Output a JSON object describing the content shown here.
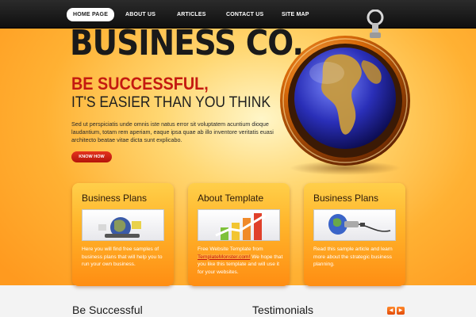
{
  "nav": {
    "items": [
      {
        "label": "HOME PAGE",
        "active": true
      },
      {
        "label": "ABOUT US",
        "active": false
      },
      {
        "label": "ARTICLES",
        "active": false
      },
      {
        "label": "CONTACT US",
        "active": false
      },
      {
        "label": "SITE MAP",
        "active": false
      }
    ]
  },
  "brand": {
    "name": "BUSINESS CO."
  },
  "hero": {
    "headline_line1": "BE SUCCESSFUL,",
    "headline_line2": "IT'S EASIER THAN YOU THINK",
    "intro": "Sed ut perspiciatis unde omnis iste natus error sit voluptatem acuntium dioque laudantium, totam rem aperiam, eaque ipsa quae ab illo inventore veritatis euasi architecto beatae vitae dicta sunt explicabo.",
    "button_label": "KNOW HOW"
  },
  "cards": [
    {
      "title": "Business Plans",
      "text_before": "Here you will find free samples of business plans that will help you to run your own business.",
      "link": "",
      "text_after": ""
    },
    {
      "title": "About Template",
      "text_before": "Free Website Template from ",
      "link": "TemplateMonster.com!",
      "text_after": " We hope that you like this template and will use it for your websites."
    },
    {
      "title": "Business Plans",
      "text_before": "Read this sample article and learn more about the strategic business planning.",
      "link": "",
      "text_after": ""
    }
  ],
  "bottom": {
    "left_title": "Be Successful",
    "right_title": "Testimonials",
    "prev_symbol": "◀",
    "next_symbol": "▶"
  },
  "colors": {
    "accent_red": "#c41a10",
    "orange": "#ff9a1f",
    "nav_bg": "#1a1a1a"
  }
}
